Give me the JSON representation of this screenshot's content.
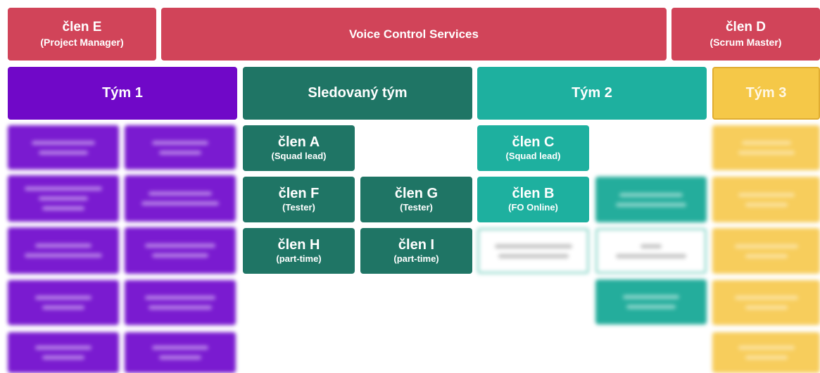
{
  "header": {
    "left": {
      "name": "člen E",
      "role": "(Project Manager)"
    },
    "center": {
      "title": "Voice Control Services"
    },
    "right": {
      "name": "člen D",
      "role": "(Scrum Master)"
    }
  },
  "teams": {
    "team1": "Tým 1",
    "tracked": "Sledovaný tým",
    "team2": "Tým 2",
    "team3": "Tým 3"
  },
  "members": {
    "a": {
      "name": "člen A",
      "role": "(Squad lead)"
    },
    "f": {
      "name": "člen F",
      "role": "(Tester)"
    },
    "g": {
      "name": "člen G",
      "role": "(Tester)"
    },
    "h": {
      "name": "člen H",
      "role": "(part-time)"
    },
    "i": {
      "name": "člen I",
      "role": "(part-time)"
    },
    "c": {
      "name": "člen C",
      "role": "(Squad lead)"
    },
    "b": {
      "name": "člen B",
      "role": "(FO Online)"
    }
  },
  "colors": {
    "header": "#d14459",
    "team1": "#7008c8",
    "tracked_team": "#1f7565",
    "team2": "#1eb09f",
    "team3": "#f5c848"
  }
}
